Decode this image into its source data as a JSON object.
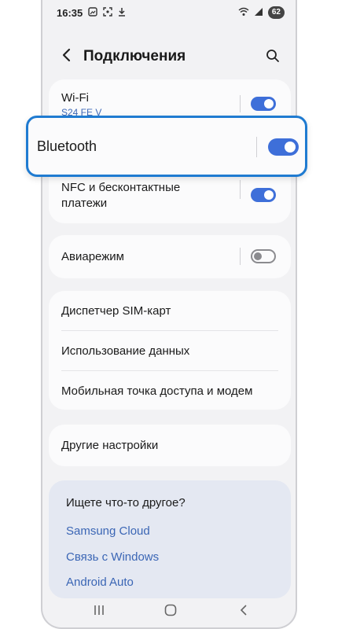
{
  "status": {
    "time": "16:35",
    "battery": "62"
  },
  "header": {
    "title": "Подключения"
  },
  "connections": {
    "wifi": {
      "label": "Wi-Fi",
      "network": "S24 FE V",
      "enabled": true
    },
    "bluetooth": {
      "label": "Bluetooth",
      "enabled": true
    },
    "nfc": {
      "label_line1": "NFC и бесконтактные",
      "label_line2": "платежи",
      "enabled": true
    }
  },
  "airplane": {
    "label": "Авиарежим",
    "enabled": false
  },
  "sim_group": {
    "items": [
      "Диспетчер SIM-карт",
      "Использование данных",
      "Мобильная точка доступа и модем"
    ]
  },
  "other": {
    "label": "Другие настройки"
  },
  "suggestions": {
    "heading": "Ищете что-то другое?",
    "links": [
      "Samsung Cloud",
      "Связь с Windows",
      "Android Auto"
    ]
  },
  "colors": {
    "accent": "#3e6fd9",
    "highlight": "#1f7bd1",
    "link": "#3b66b5"
  }
}
